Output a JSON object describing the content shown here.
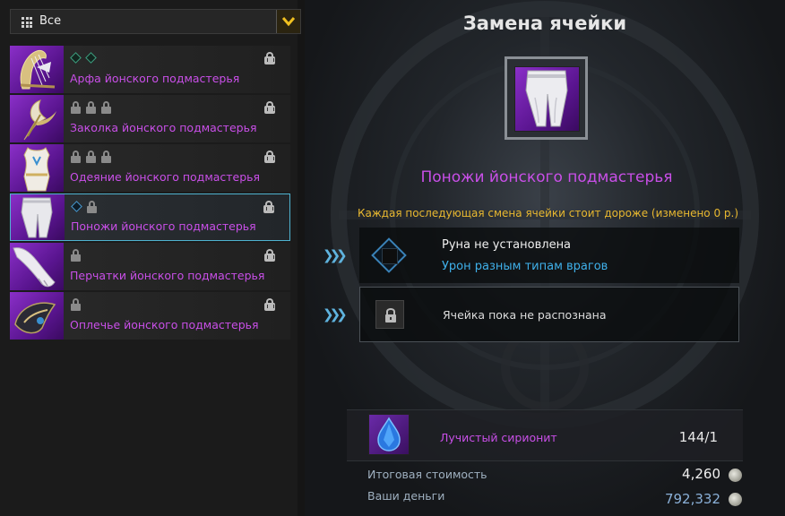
{
  "filter": {
    "selected": "Все"
  },
  "items": [
    {
      "name": "Арфа йонского подмастерья",
      "slots": [
        "gem",
        "gem-blue"
      ]
    },
    {
      "name": "Заколка йонского подмастерья",
      "slots": [
        "lock",
        "lock",
        "lock"
      ]
    },
    {
      "name": "Одеяние йонского подмастерья",
      "slots": [
        "lock",
        "lock",
        "lock"
      ]
    },
    {
      "name": "Поножи йонского подмастерья",
      "slots": [
        "gem-blue",
        "lock"
      ],
      "selected": true
    },
    {
      "name": "Перчатки йонского подмастерья",
      "slots": [
        "lock"
      ]
    },
    {
      "name": "Оплечье йонского подмастерья",
      "slots": [
        "lock"
      ]
    }
  ],
  "panel": {
    "title": "Замена ячейки",
    "item_name": "Поножи йонского подмастерья",
    "notice": "Каждая последующая смена ячейки стоит дороже (изменено 0 р.)",
    "slot1": {
      "title": "Руна не установлена",
      "subtitle": "Урон разным типам врагов"
    },
    "slot2": {
      "text": "Ячейка пока не распознана"
    },
    "material": {
      "name": "Лучистый сирионит",
      "count": "144/1"
    },
    "total_cost": {
      "label": "Итоговая стоимость",
      "value": "4,260"
    },
    "your_money": {
      "label": "Ваши деньги",
      "value": "792,332"
    }
  },
  "colors": {
    "accent_purple": "#c94fe8",
    "notice_yellow": "#e8b830",
    "link_blue": "#3fb0ea"
  }
}
